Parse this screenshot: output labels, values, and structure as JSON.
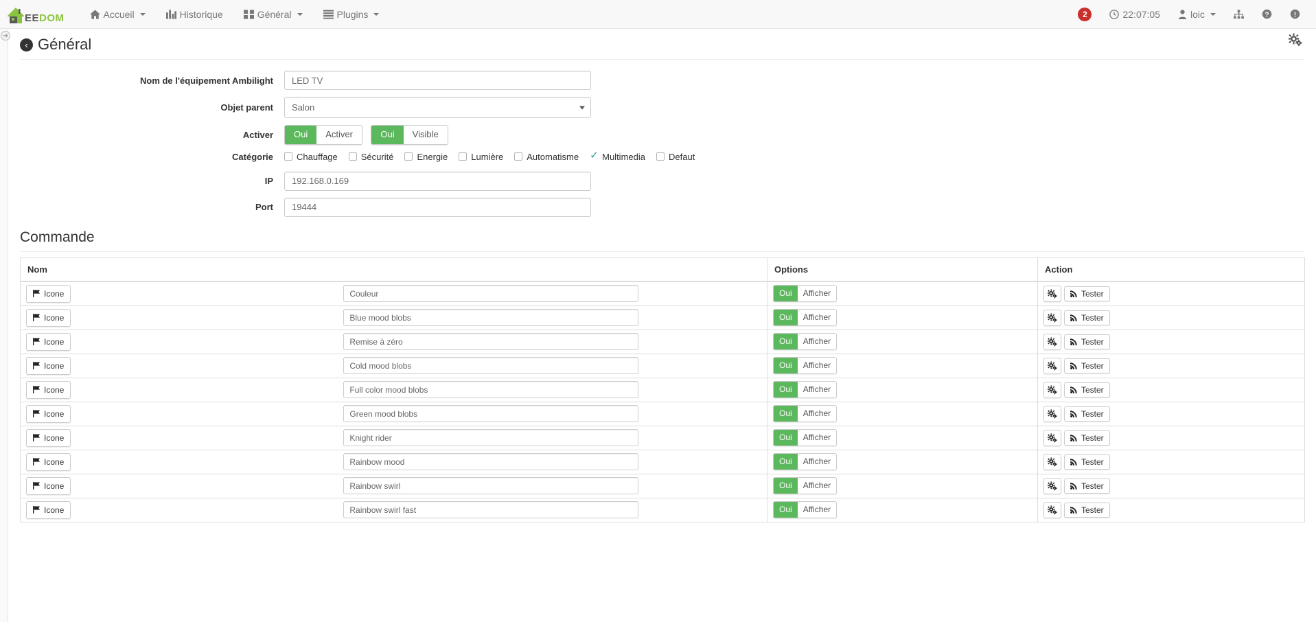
{
  "navbar": {
    "brand": {
      "gray": "EE",
      "green": "DOM",
      "icon": "jeedom-house-logo"
    },
    "items": [
      {
        "label": "Accueil",
        "icon": "home-icon",
        "caret": true
      },
      {
        "label": "Historique",
        "icon": "chart-bar-icon",
        "caret": false
      },
      {
        "label": "Général",
        "icon": "th-large-icon",
        "caret": true
      },
      {
        "label": "Plugins",
        "icon": "list-icon",
        "caret": true
      }
    ],
    "right": {
      "badge_count": "2",
      "badge_color": "#c9302c",
      "clock_icon": "clock-icon",
      "time": "22:07:05",
      "user_icon": "user-icon",
      "user": "loic",
      "network_icon": "sitemap-icon",
      "help_icon": "question-circle-icon",
      "info_icon": "exclamation-circle-icon"
    }
  },
  "page": {
    "back_icon": "arrow-circle-left-icon",
    "title": "Général",
    "gear_icon": "cogs-icon",
    "rail_toggle_icon": "arrow-circle-right-icon"
  },
  "form": {
    "fields": [
      {
        "label": "Nom de l'équipement Ambilight",
        "value": "LED TV",
        "placeholder": "Nom de l'équipement",
        "type": "text",
        "name": "equipment-name-field"
      },
      {
        "label": "Objet parent",
        "value": "Salon",
        "type": "select",
        "name": "parent-object-select",
        "options": [
          "Salon"
        ]
      },
      {
        "label": "IP",
        "value": "192.168.0.169",
        "placeholder": "IP",
        "type": "text",
        "name": "ip-field"
      },
      {
        "label": "Port",
        "value": "19444",
        "placeholder": "Port",
        "type": "text",
        "name": "port-field"
      }
    ],
    "activer": {
      "label": "Activer",
      "groups": [
        {
          "on_label": "Oui",
          "off_label": "Activer",
          "active": true,
          "name": "enable-toggle"
        },
        {
          "on_label": "Oui",
          "off_label": "Visible",
          "active": true,
          "name": "visible-toggle"
        }
      ]
    },
    "categorie": {
      "label": "Catégorie",
      "items": [
        {
          "label": "Chauffage",
          "checked": false
        },
        {
          "label": "Sécurité",
          "checked": false
        },
        {
          "label": "Energie",
          "checked": false
        },
        {
          "label": "Lumière",
          "checked": false
        },
        {
          "label": "Automatisme",
          "checked": false
        },
        {
          "label": "Multimedia",
          "checked": true
        },
        {
          "label": "Defaut",
          "checked": false
        }
      ],
      "check_color": "#2aa198"
    }
  },
  "commande": {
    "title": "Commande",
    "headers": {
      "nom": "Nom",
      "options": "Options",
      "action": "Action"
    },
    "icone_button_label": "Icone",
    "icone_button_icon": "flag-icon",
    "option_on_label": "Oui",
    "option_off_label": "Afficher",
    "action_config_icon": "cogs-icon",
    "action_test_icon": "rss-icon",
    "action_test_label": "Tester",
    "rows": [
      {
        "name": "Couleur",
        "show": true
      },
      {
        "name": "Blue mood blobs",
        "show": true
      },
      {
        "name": "Remise à zéro",
        "show": true
      },
      {
        "name": "Cold mood blobs",
        "show": true
      },
      {
        "name": "Full color mood blobs",
        "show": true
      },
      {
        "name": "Green mood blobs",
        "show": true
      },
      {
        "name": "Knight rider",
        "show": true
      },
      {
        "name": "Rainbow mood",
        "show": true
      },
      {
        "name": "Rainbow swirl",
        "show": true
      },
      {
        "name": "Rainbow swirl fast",
        "show": true
      }
    ]
  },
  "colors": {
    "accent_green": "#5cb85c",
    "brand_green": "#8bc53f",
    "navbar_bg": "#f8f8f8",
    "danger_red": "#c9302c"
  }
}
